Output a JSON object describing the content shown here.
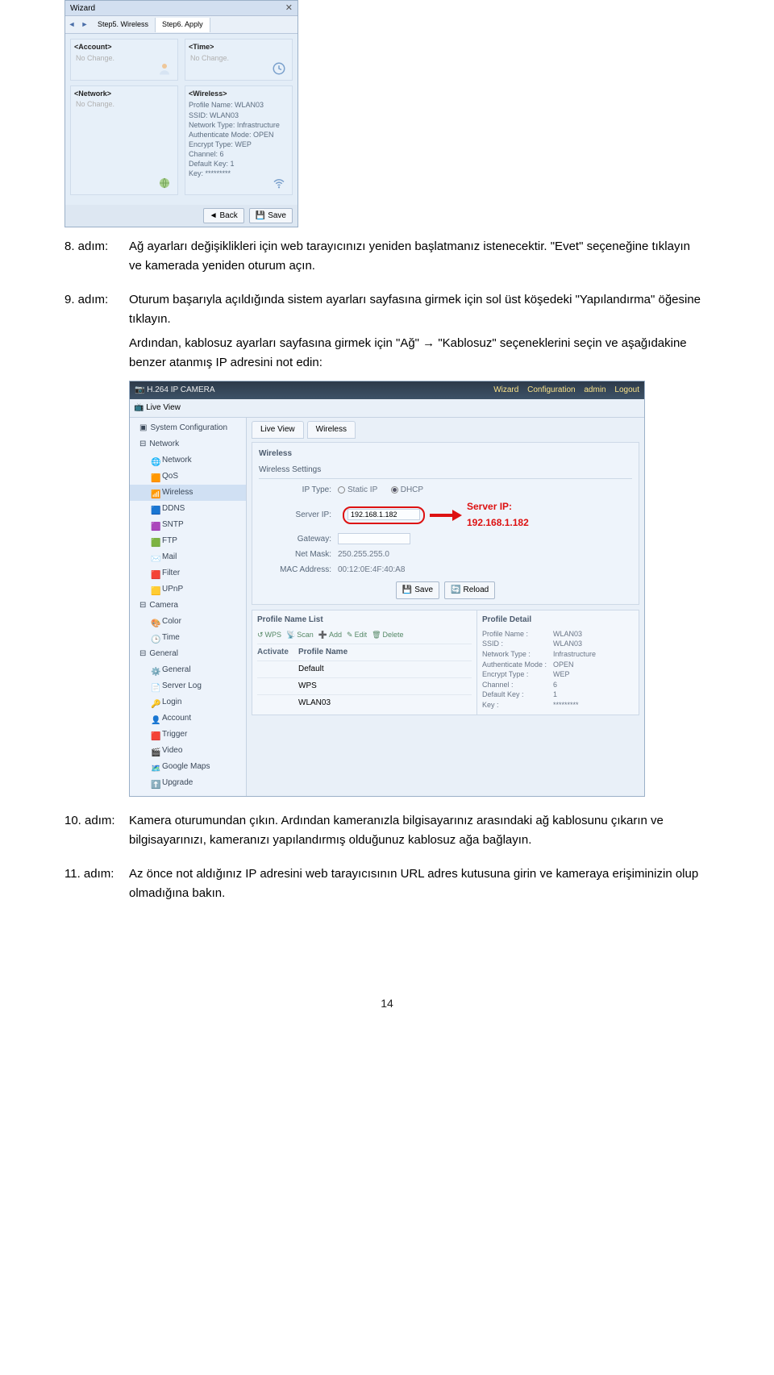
{
  "wizard": {
    "title": "Wizard",
    "tab_prev": "Step5. Wireless",
    "tab_active": "Step6. Apply",
    "account": {
      "header": "<Account>",
      "value": "No Change."
    },
    "time": {
      "header": "<Time>",
      "value": "No Change."
    },
    "network": {
      "header": "<Network>",
      "value": "No Change."
    },
    "wireless": {
      "header": "<Wireless>",
      "lines": [
        "Profile Name: WLAN03",
        "SSID: WLAN03",
        "Network Type: Infrastructure",
        "Authenticate Mode: OPEN",
        "Encrypt Type: WEP",
        "Channel: 6",
        "Default Key: 1",
        "Key: *********"
      ]
    },
    "back_label": "Back",
    "save_label": "Save"
  },
  "steps": {
    "s8": {
      "label": "8. adım:",
      "text": "Ağ ayarları değişiklikleri için web tarayıcınızı yeniden başlatmanız istenecektir. \"Evet\" seçeneğine tıklayın ve kamerada yeniden oturum açın."
    },
    "s9": {
      "label": "9. adım:",
      "text1": "Oturum başarıyla açıldığında sistem ayarları sayfasına girmek için sol üst köşedeki \"Yapılandırma\" öğesine tıklayın.",
      "text2": "Ardından, kablosuz ayarları sayfasına girmek için \"Ağ\" → \"Kablosuz\" seçeneklerini seçin ve aşağıdakine benzer atanmış IP adresini not edin:"
    },
    "s10": {
      "label": "10. adım:",
      "text": "Kamera oturumundan çıkın. Ardından kameranızla bilgisayarınız arasındaki ağ kablosunu çıkarın ve bilgisayarınızı, kameranızı yapılandırmış olduğunuz kablosuz ağa bağlayın."
    },
    "s11": {
      "label": "11. adım:",
      "text": "Az önce not aldığınız IP adresini web tarayıcısının URL adres kutusuna girin ve kameraya erişiminizin olup olmadığına bakın."
    }
  },
  "app": {
    "title": "H.264 IP CAMERA",
    "nav": [
      "Wizard",
      "Configuration",
      "admin",
      "Logout"
    ],
    "liveview": "Live View",
    "tabs": {
      "liveview": "Live View",
      "wireless": "Wireless"
    },
    "sidebar": {
      "group_sysconf": "System Configuration",
      "group_network": "Network",
      "items_network": [
        "Network",
        "QoS",
        "Wireless",
        "DDNS",
        "SNTP",
        "FTP",
        "Mail",
        "Filter",
        "UPnP"
      ],
      "group_camera": "Camera",
      "items_camera": [
        "Color",
        "Time"
      ],
      "group_general": "General",
      "items_general": [
        "General",
        "Server Log",
        "Login",
        "Account",
        "Trigger",
        "Video",
        "Google Maps",
        "Upgrade"
      ]
    },
    "panel": {
      "heading": "Wireless",
      "settings": "Wireless Settings",
      "ip_type": "IP Type:",
      "static_ip": "Static IP",
      "dhcp": "DHCP",
      "server_ip": "Server IP:",
      "server_ip_val": "192.168.1.182",
      "callout": "Server IP: 192.168.1.182",
      "gateway": "Gateway:",
      "netmask": "Net Mask:",
      "netmask_val": "250.255.255.0",
      "mac": "MAC Address:",
      "mac_val": "00:12:0E:4F:40:A8",
      "save": "Save",
      "reload": "Reload"
    },
    "profiles": {
      "heading_list": "Profile Name List",
      "toolbar": [
        "WPS",
        "Scan",
        "Add",
        "Edit",
        "Delete"
      ],
      "th_activate": "Activate",
      "th_pname": "Profile Name",
      "rows": [
        "Default",
        "WPS",
        "WLAN03"
      ],
      "heading_detail": "Profile Detail",
      "details": [
        [
          "Profile Name :",
          "WLAN03"
        ],
        [
          "SSID :",
          "WLAN03"
        ],
        [
          "Network Type :",
          "Infrastructure"
        ],
        [
          "Authenticate Mode :",
          "OPEN"
        ],
        [
          "Encrypt Type :",
          "WEP"
        ],
        [
          "Channel :",
          "6"
        ],
        [
          "Default Key :",
          "1"
        ],
        [
          "Key :",
          "*********"
        ]
      ]
    }
  },
  "page_number": "14"
}
